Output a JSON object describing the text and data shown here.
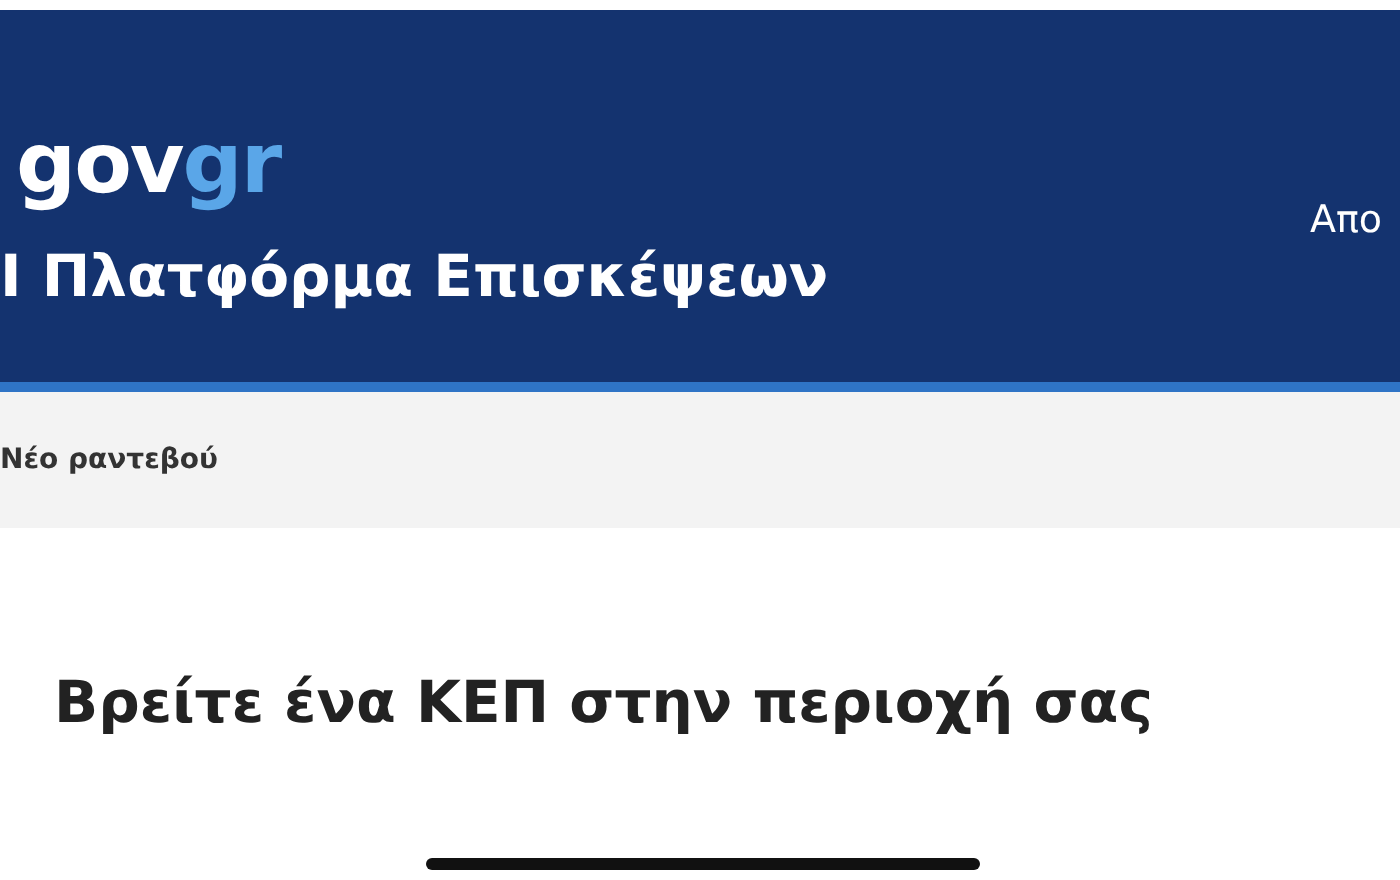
{
  "header": {
    "logo": {
      "main": "gov",
      "accent": "gr"
    },
    "title": "Ι Πλατφόρμα Επισκέψεων",
    "action": "Απο"
  },
  "nav": {
    "items": [
      {
        "label": "Νέο ραντεβού"
      }
    ]
  },
  "main": {
    "heading": "Βρείτε ένα ΚΕΠ στην περιοχή σας"
  }
}
